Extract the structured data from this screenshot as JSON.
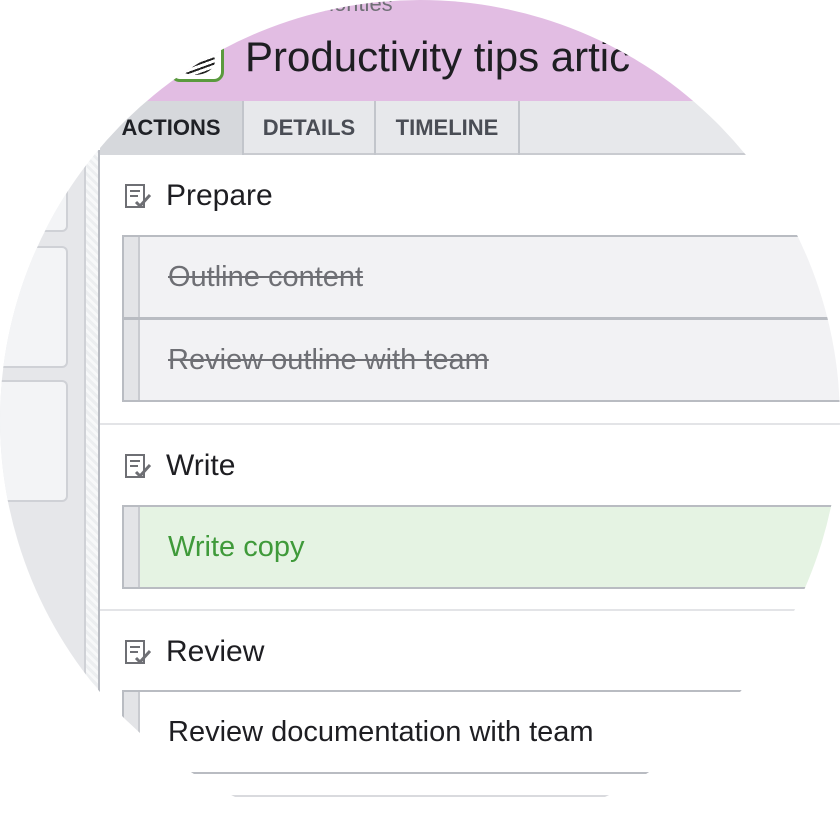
{
  "header": {
    "breadcrumb": "y Priorities",
    "title": "Productivity tips artic",
    "accent": "#e2bde3"
  },
  "tabs": [
    {
      "label": "ACTIONS",
      "active": true
    },
    {
      "label": "DETAILS",
      "active": false
    },
    {
      "label": "TIMELINE",
      "active": false
    }
  ],
  "sections": [
    {
      "title": "Prepare",
      "icon": "checklist-icon",
      "tasks": [
        {
          "label": "Outline content",
          "status": "done"
        },
        {
          "label": "Review outline with team",
          "status": "done"
        }
      ]
    },
    {
      "title": "Write",
      "icon": "checklist-icon",
      "tasks": [
        {
          "label": "Write copy",
          "status": "active"
        }
      ]
    },
    {
      "title": "Review",
      "icon": "checklist-icon",
      "tasks": [
        {
          "label": "Review documentation with team",
          "status": "todo"
        }
      ]
    }
  ],
  "colors": {
    "active_task_bg": "#e5f3e3",
    "active_task_text": "#3f9a3a",
    "done_task_text": "#6e6f74"
  }
}
